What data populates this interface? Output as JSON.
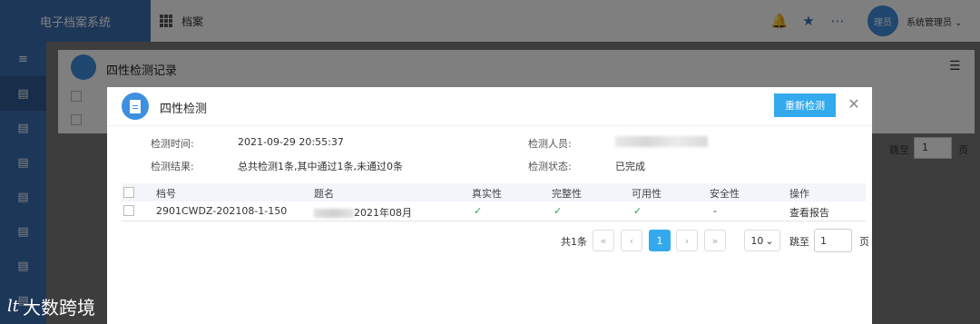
{
  "app": {
    "title": "电子档案系统",
    "breadcrumb": "档案"
  },
  "header": {
    "user_avatar_text": "理员",
    "user_name": "系统管理员 ⌄",
    "icons": [
      "bell-icon",
      "star-icon",
      "more-icon"
    ]
  },
  "background": {
    "panel_title": "四性检测记录",
    "jump_label": "跳至",
    "jump_value": "1",
    "page_label": "页"
  },
  "modal": {
    "title": "四性检测",
    "recheck_button": "重新检测",
    "close_glyph": "✕",
    "info": {
      "time_label": "检测时间:",
      "time_value": "2021-09-29 20:55:37",
      "result_label": "检测结果:",
      "result_value": "总共检测1条,其中通过1条,未通过0条",
      "inspector_label": "检测人员:",
      "status_label": "检测状态:",
      "status_value": "已完成"
    },
    "table": {
      "columns": [
        "档号",
        "题名",
        "真实性",
        "完整性",
        "可用性",
        "安全性",
        "操作"
      ],
      "rows": [
        {
          "doc_no": "2901CWDZ-202108-1-150",
          "title_suffix": "2021年08月",
          "authenticity": "✓",
          "integrity": "✓",
          "usability": "✓",
          "security": "-",
          "action": "查看报告"
        }
      ]
    },
    "pager": {
      "total": "共1条",
      "first": "«",
      "prev": "‹",
      "current": "1",
      "next": "›",
      "last": "»",
      "page_size": "10",
      "jump_label": "跳至",
      "jump_value": "1",
      "page_label": "页"
    }
  },
  "watermark": {
    "logo": "lt",
    "text": "大数跨境"
  }
}
